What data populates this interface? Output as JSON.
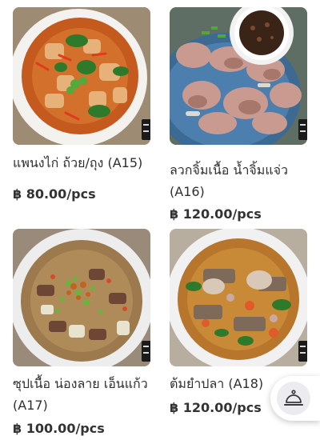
{
  "menu": {
    "items": [
      {
        "name": "แพนงไก่ ถ้วย/ถุง (A15)",
        "price": "฿ 80.00/pcs",
        "image": "panang-chicken-curry"
      },
      {
        "name": "ลวกจิ้มเนื้อ น้ำจิ้มแจ่ว (A16)",
        "price": "฿ 120.00/pcs",
        "image": "blanched-beef-with-jaew-dip"
      },
      {
        "name": "ซุปเนื้อ น่องลาย เอ็นแก้ว (A17)",
        "price": "฿ 100.00/pcs",
        "image": "beef-shank-tendon-soup"
      },
      {
        "name": "ต้มยำปลา (A18)",
        "price": "฿ 120.00/pcs",
        "image": "tom-yum-fish-soup"
      }
    ]
  },
  "call_staff": {
    "icon": "bell-service-icon"
  },
  "colors": {
    "background": "#ffffff",
    "text": "#2f2f2f",
    "fab_circle": "#ececf0"
  }
}
